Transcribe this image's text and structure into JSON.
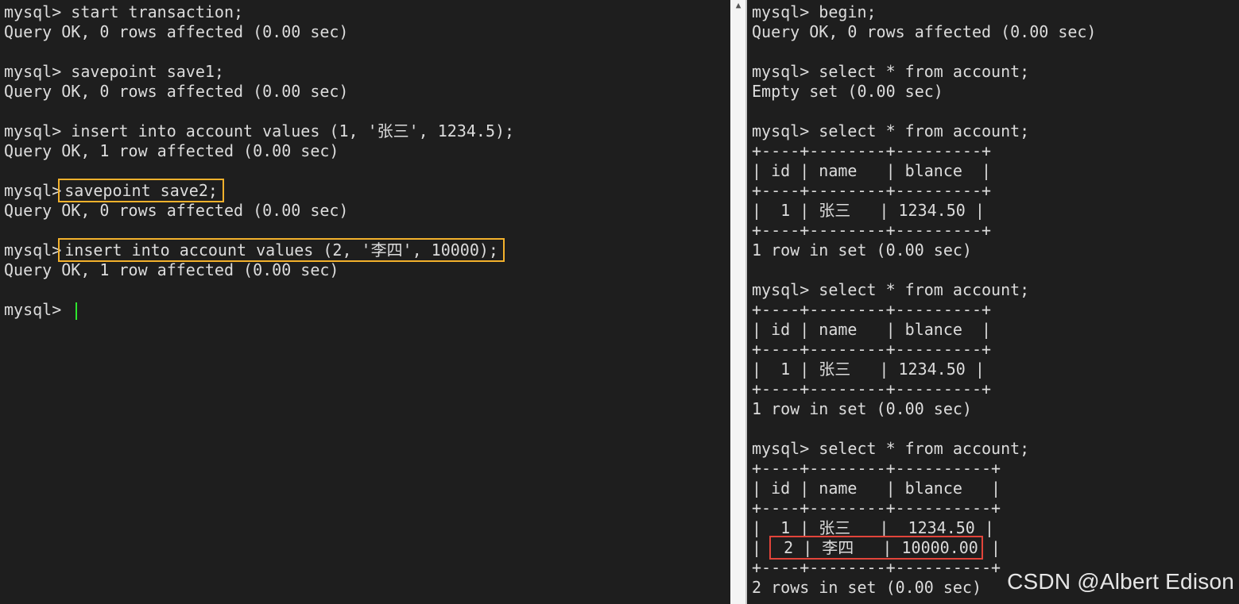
{
  "left_terminal": {
    "lines": [
      {
        "prompt": "mysql> ",
        "cmd": "start transaction;"
      },
      {
        "text": "Query OK, 0 rows affected (0.00 sec)"
      },
      {
        "text": ""
      },
      {
        "prompt": "mysql> ",
        "cmd": "savepoint save1;"
      },
      {
        "text": "Query OK, 0 rows affected (0.00 sec)"
      },
      {
        "text": ""
      },
      {
        "prompt": "mysql> ",
        "cmd": "insert into account values (1, '张三', 1234.5);"
      },
      {
        "text": "Query OK, 1 row affected (0.00 sec)"
      },
      {
        "text": ""
      },
      {
        "prompt": "mysql>",
        "cmd": "savepoint save2;",
        "highlight": "yellow"
      },
      {
        "text": "Query OK, 0 rows affected (0.00 sec)"
      },
      {
        "text": ""
      },
      {
        "prompt": "mysql>",
        "cmd": "insert into account values (2, '李四', 10000);",
        "highlight": "yellow"
      },
      {
        "text": "Query OK, 1 row affected (0.00 sec)"
      },
      {
        "text": ""
      },
      {
        "prompt": "mysql> ",
        "cursor": true
      }
    ]
  },
  "right_terminal": {
    "lines": [
      {
        "text": "mysql> begin;"
      },
      {
        "text": "Query OK, 0 rows affected (0.00 sec)"
      },
      {
        "text": ""
      },
      {
        "text": "mysql> select * from account;"
      },
      {
        "text": "Empty set (0.00 sec)"
      },
      {
        "text": ""
      },
      {
        "text": "mysql> select * from account;"
      },
      {
        "text": "+----+--------+---------+"
      },
      {
        "text": "| id | name   | blance  |"
      },
      {
        "text": "+----+--------+---------+"
      },
      {
        "text": "|  1 | 张三   | 1234.50 |"
      },
      {
        "text": "+----+--------+---------+"
      },
      {
        "text": "1 row in set (0.00 sec)"
      },
      {
        "text": ""
      },
      {
        "text": "mysql> select * from account;"
      },
      {
        "text": "+----+--------+---------+"
      },
      {
        "text": "| id | name   | blance  |"
      },
      {
        "text": "+----+--------+---------+"
      },
      {
        "text": "|  1 | 张三   | 1234.50 |"
      },
      {
        "text": "+----+--------+---------+"
      },
      {
        "text": "1 row in set (0.00 sec)"
      },
      {
        "text": ""
      },
      {
        "text": "mysql> select * from account;"
      },
      {
        "text": "+----+--------+----------+"
      },
      {
        "text": "| id | name   | blance   |"
      },
      {
        "text": "+----+--------+----------+"
      },
      {
        "text": "|  1 | 张三   |  1234.50 |"
      },
      {
        "pre": "| ",
        "text": " 2 | 李四   | 10000.00",
        "post": " |",
        "highlight": "red"
      },
      {
        "text": "+----+--------+----------+"
      },
      {
        "text": "2 rows in set (0.00 sec)"
      }
    ]
  },
  "watermark": "CSDN @Albert Edison",
  "colors": {
    "background": "#1e1e1e",
    "text": "#dcdcdc",
    "highlight_yellow": "#f3b12c",
    "highlight_red": "#e2443a",
    "cursor": "#2ee52e"
  }
}
